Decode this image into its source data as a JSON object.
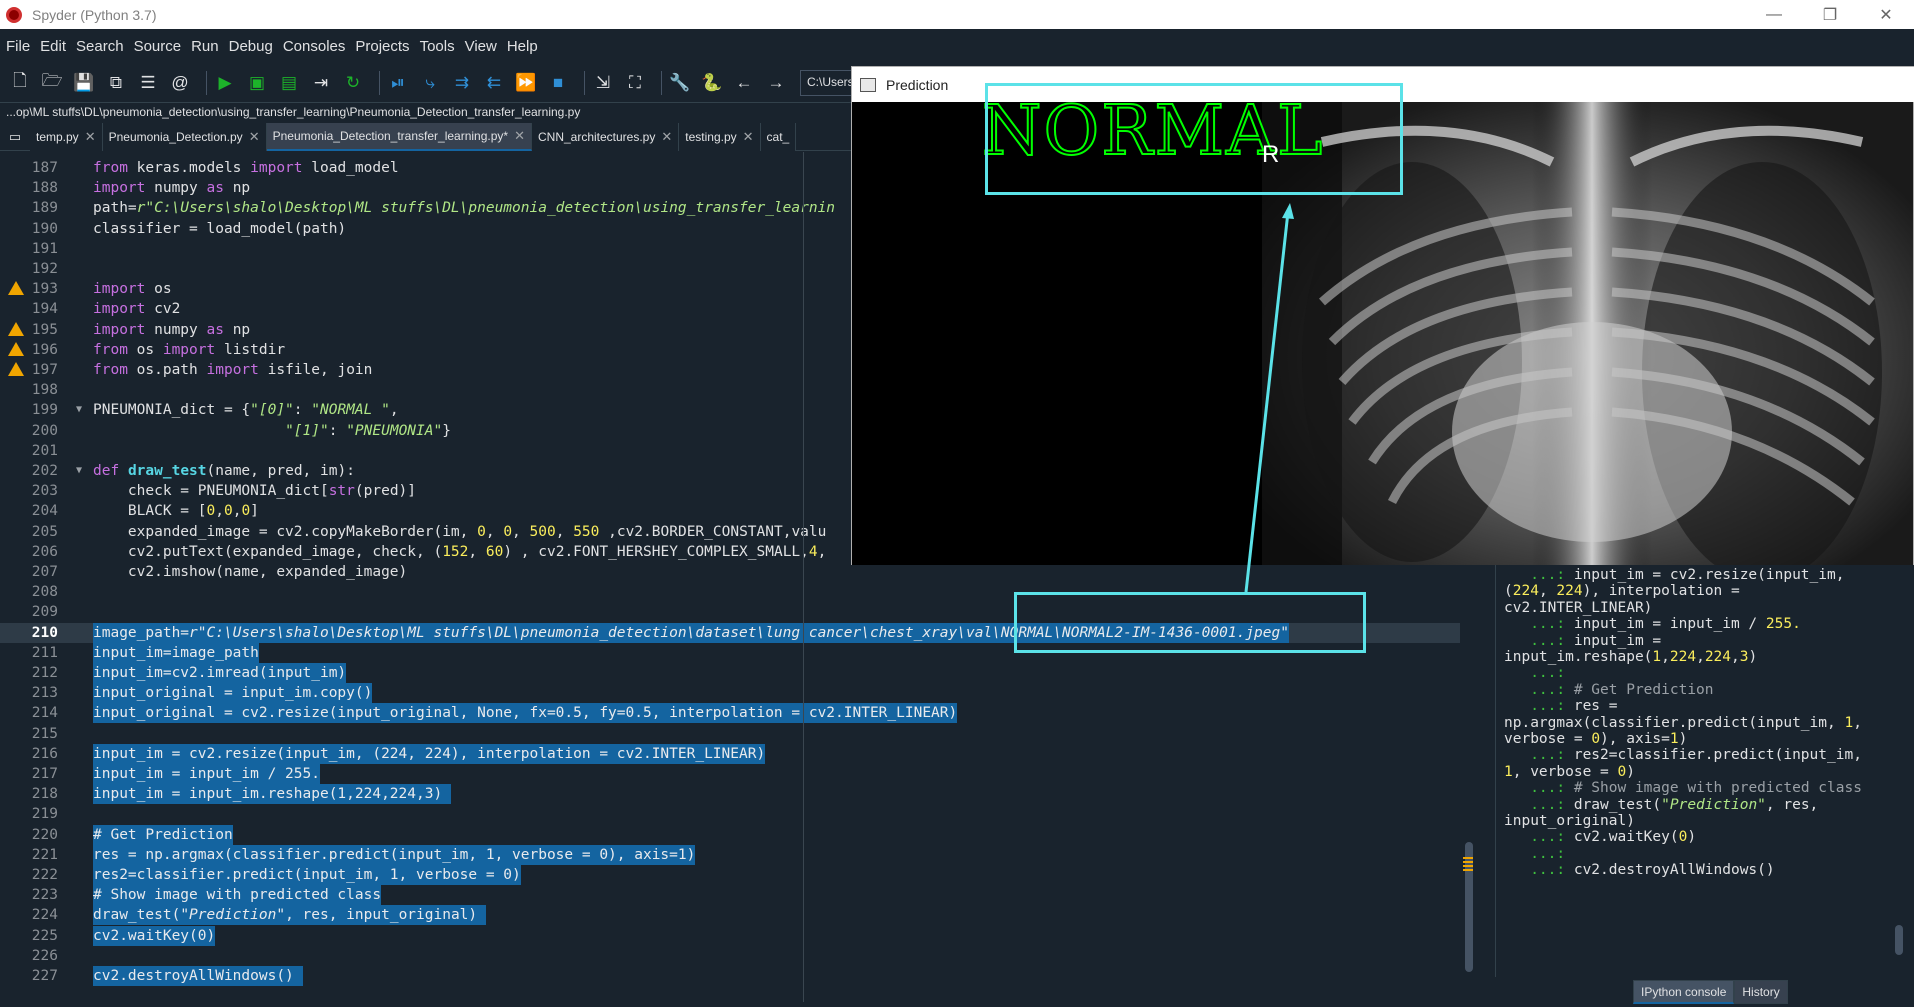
{
  "window": {
    "title": "Spyder (Python 3.7)",
    "controls": [
      "—",
      "❐",
      "✕"
    ]
  },
  "menu": [
    "File",
    "Edit",
    "Search",
    "Source",
    "Run",
    "Debug",
    "Consoles",
    "Projects",
    "Tools",
    "View",
    "Help"
  ],
  "toolbar": {
    "path_value": "C:\\Users"
  },
  "filepath": "...op\\ML stuffs\\DL\\pneumonia_detection\\using_transfer_learning\\Pneumonia_Detection_transfer_learning.py",
  "tabs": [
    {
      "label": "temp.py",
      "active": false
    },
    {
      "label": "Pneumonia_Detection.py",
      "active": false
    },
    {
      "label": "Pneumonia_Detection_transfer_learning.py*",
      "active": true
    },
    {
      "label": "CNN_architectures.py",
      "active": false
    },
    {
      "label": "testing.py",
      "active": false
    },
    {
      "label": "cat_",
      "active": false
    }
  ],
  "editor": {
    "current_line": 210,
    "lines": [
      {
        "n": 187,
        "html": "<span class='kw'>from</span> keras.models <span class='kw'>import</span> load_model"
      },
      {
        "n": 188,
        "html": "<span class='kw'>import</span> numpy <span class='kw'>as</span> np"
      },
      {
        "n": 189,
        "html": "path=<span class='str'>r\"C:\\Users\\shalo\\Desktop\\ML stuffs\\DL\\pneumonia_detection\\using_transfer_learnin</span>"
      },
      {
        "n": 190,
        "html": "classifier = load_model(path)"
      },
      {
        "n": 191,
        "html": ""
      },
      {
        "n": 192,
        "html": ""
      },
      {
        "n": 193,
        "html": "<span class='kw'>import</span> os",
        "warn": true
      },
      {
        "n": 194,
        "html": "<span class='kw'>import</span> cv2"
      },
      {
        "n": 195,
        "html": "<span class='kw'>import</span> numpy <span class='kw'>as</span> np",
        "warn": true
      },
      {
        "n": 196,
        "html": "<span class='kw'>from</span> os <span class='kw'>import</span> listdir",
        "warn": true
      },
      {
        "n": 197,
        "html": "<span class='kw'>from</span> os.path <span class='kw'>import</span> isfile, join",
        "warn": true
      },
      {
        "n": 198,
        "html": ""
      },
      {
        "n": 199,
        "html": "PNEUMONIA_dict = {<span class='str'>\"[0]\"</span>: <span class='str'>\"NORMAL \"</span>,",
        "fold": true
      },
      {
        "n": 200,
        "html": "                      <span class='str'>\"[1]\"</span>: <span class='str'>\"PNEUMONIA\"</span>}"
      },
      {
        "n": 201,
        "html": ""
      },
      {
        "n": 202,
        "html": "<span class='kw'>def</span> <span class='fn'>draw_test</span>(name, pred, im):",
        "fold": true
      },
      {
        "n": 203,
        "html": "    check = PNEUMONIA_dict[<span class='bi'>str</span>(pred)]"
      },
      {
        "n": 204,
        "html": "    BLACK = [<span class='num'>0</span>,<span class='num'>0</span>,<span class='num'>0</span>]"
      },
      {
        "n": 205,
        "html": "    expanded_image = cv2.copyMakeBorder(im, <span class='num'>0</span>, <span class='num'>0</span>, <span class='num'>500</span>, <span class='num'>550</span> ,cv2.BORDER_CONSTANT,valu"
      },
      {
        "n": 206,
        "html": "    cv2.putText(expanded_image, check, (<span class='num'>152</span>, <span class='num'>60</span>) , cv2.FONT_HERSHEY_COMPLEX_SMALL,<span class='num'>4</span>,"
      },
      {
        "n": 207,
        "html": "    cv2.imshow(name, expanded_image)"
      },
      {
        "n": 208,
        "html": ""
      },
      {
        "n": 209,
        "html": ""
      },
      {
        "n": 210,
        "html": "image_path=<span class='str'>r\"C:\\Users\\shalo\\Desktop\\ML stuffs\\DL\\pneumonia_detection\\dataset\\lung cancer\\chest_xray\\val\\NORMAL\\NORMAL2-IM-1436-0001.jpeg\"</span>",
        "sel": true
      },
      {
        "n": 211,
        "html": "input_im=image_path",
        "sel": true
      },
      {
        "n": 212,
        "html": "input_im=cv2.imread(input_im)",
        "sel": true
      },
      {
        "n": 213,
        "html": "input_original = input_im.copy()",
        "sel": true
      },
      {
        "n": 214,
        "html": "input_original = cv2.resize(input_original, None, fx=0.5, fy=0.5, interpolation = cv2.INTER_LINEAR)",
        "sel": true
      },
      {
        "n": 215,
        "html": "",
        "sel": true
      },
      {
        "n": 216,
        "html": "input_im = cv2.resize(input_im, (224, 224), interpolation = cv2.INTER_LINEAR)",
        "sel": true
      },
      {
        "n": 217,
        "html": "input_im = input_im / 255.",
        "sel": true
      },
      {
        "n": 218,
        "html": "input_im = input_im.reshape(1,224,224,3) ",
        "sel": true
      },
      {
        "n": 219,
        "html": "",
        "sel": true
      },
      {
        "n": 220,
        "html": "# Get Prediction",
        "sel": true
      },
      {
        "n": 221,
        "html": "res = np.argmax(classifier.predict(input_im, 1, verbose = 0), axis=1)",
        "sel": true
      },
      {
        "n": 222,
        "html": "res2=classifier.predict(input_im, 1, verbose = 0)",
        "sel": true
      },
      {
        "n": 223,
        "html": "# Show image with predicted class",
        "sel": true
      },
      {
        "n": 224,
        "html": "draw_test(<span class='str'>\"Prediction\"</span>, res, input_original) ",
        "sel": true
      },
      {
        "n": 225,
        "html": "cv2.waitKey(0)",
        "sel": true
      },
      {
        "n": 226,
        "html": "",
        "sel": true
      },
      {
        "n": 227,
        "html": "cv2.destroyAllWindows() ",
        "sel": true
      }
    ]
  },
  "console": {
    "lines": [
      "<span class='pr'>   ...:</span> input_im = cv2.resize(input_im,",
      "(<span class='n'>224</span>, <span class='n'>224</span>), interpolation =",
      "cv2.INTER_LINEAR)",
      "<span class='pr'>   ...:</span> input_im = input_im / <span class='n'>255.</span>",
      "<span class='pr'>   ...:</span> input_im =",
      "input_im.reshape(<span class='n'>1</span>,<span class='n'>224</span>,<span class='n'>224</span>,<span class='n'>3</span>)",
      "<span class='pr'>   ...:</span>",
      "<span class='pr'>   ...:</span> <span class='cm'># Get Prediction</span>",
      "<span class='pr'>   ...:</span> res =",
      "np.argmax(classifier.predict(input_im, <span class='n'>1</span>,",
      "verbose = <span class='n'>0</span>), axis=<span class='n'>1</span>)",
      "<span class='pr'>   ...:</span> res2=classifier.predict(input_im,",
      "<span class='n'>1</span>, verbose = <span class='n'>0</span>)",
      "<span class='pr'>   ...:</span> <span class='cm'># Show image with predicted class</span>",
      "<span class='pr'>   ...:</span> draw_test(<span class='s'>\"Prediction\"</span>, res,",
      "input_original)",
      "<span class='pr'>   ...:</span> cv2.waitKey(<span class='n'>0</span>)",
      "<span class='pr'>   ...:</span>",
      "<span class='pr'>   ...:</span> cv2.destroyAllWindows()"
    ],
    "tabs": [
      "IPython console",
      "History"
    ]
  },
  "prediction": {
    "title": "Prediction",
    "label": "NORMAL",
    "label_color": "#00ff00",
    "cursor_glyph": "R"
  },
  "colors": {
    "accent": "#1464a0",
    "annotation": "#5be2e8",
    "background": "#19232d"
  }
}
